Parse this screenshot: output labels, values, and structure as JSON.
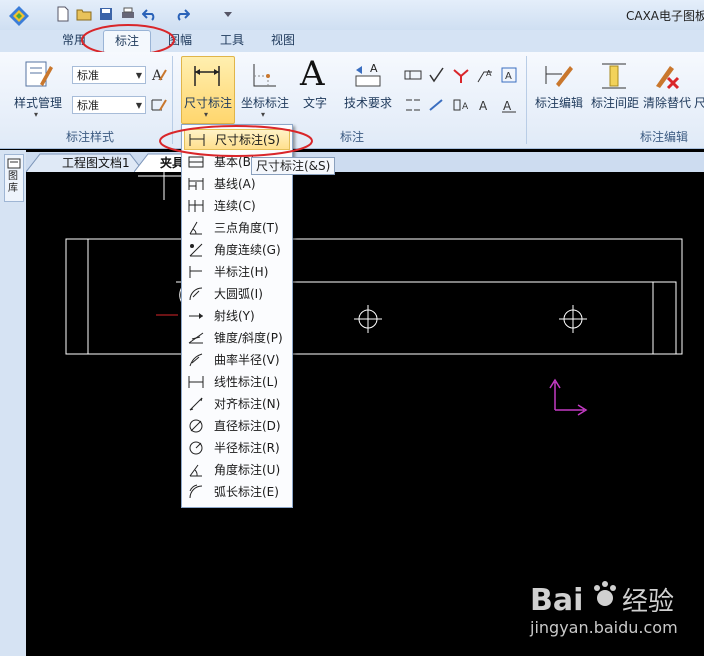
{
  "window": {
    "title": "CAXA电子图板"
  },
  "tabs": [
    {
      "label": "常用"
    },
    {
      "label": "标注"
    },
    {
      "label": "图幅"
    },
    {
      "label": "工具"
    },
    {
      "label": "视图"
    }
  ],
  "ribbon": {
    "style_manage": "样式管理",
    "combo1": "标准",
    "combo2": "标准",
    "group_style_label": "标注样式",
    "dim_label": "尺寸标注",
    "coord_label": "坐标标注",
    "text_label": "文字",
    "tech_label": "技术要求",
    "group_annot_label": "标注",
    "edit_label": "标注编辑",
    "spacing_label": "标注间距",
    "clear_label": "清除替代",
    "extra_label": "尺",
    "group_edit_label": "标注编辑",
    "text_icon_glyph": "A"
  },
  "doc_tabs": [
    {
      "label": "工程图文档1"
    },
    {
      "label": "夹具"
    }
  ],
  "side_label": "图库",
  "dropdown": {
    "items": [
      {
        "label": "尺寸标注(S)",
        "icon": "dimension-icon"
      },
      {
        "label": "基本(B)",
        "icon": "basic-dim-icon"
      },
      {
        "label": "基线(A)",
        "icon": "baseline-icon"
      },
      {
        "label": "连续(C)",
        "icon": "continuous-icon"
      },
      {
        "label": "三点角度(T)",
        "icon": "three-point-angle-icon"
      },
      {
        "label": "角度连续(G)",
        "icon": "angle-continuous-icon"
      },
      {
        "label": "半标注(H)",
        "icon": "half-dim-icon"
      },
      {
        "label": "大圆弧(I)",
        "icon": "large-arc-icon"
      },
      {
        "label": "射线(Y)",
        "icon": "ray-icon"
      },
      {
        "label": "锥度/斜度(P)",
        "icon": "taper-icon"
      },
      {
        "label": "曲率半径(V)",
        "icon": "curvature-icon"
      },
      {
        "label": "线性标注(L)",
        "icon": "linear-icon"
      },
      {
        "label": "对齐标注(N)",
        "icon": "aligned-icon"
      },
      {
        "label": "直径标注(D)",
        "icon": "diameter-icon"
      },
      {
        "label": "半径标注(R)",
        "icon": "radius-icon"
      },
      {
        "label": "角度标注(U)",
        "icon": "angle-icon"
      },
      {
        "label": "弧长标注(E)",
        "icon": "arc-length-icon"
      }
    ]
  },
  "tooltip": "尺寸标注(&S)",
  "watermark": {
    "logo": "Baidu经验",
    "url": "jingyan.baidu.com"
  },
  "colors": {
    "annotation_red": "#d9262a",
    "axis_magenta": "#c43bc4",
    "canvas_bg": "#000000"
  }
}
